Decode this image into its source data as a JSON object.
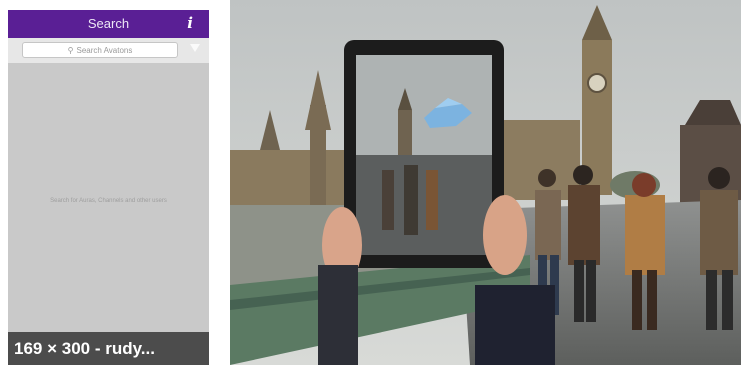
{
  "app": {
    "title": "Search",
    "info_icon": "info-icon",
    "search": {
      "placeholder": "Search Avatons",
      "icon": "search-icon"
    },
    "filter_icon": "filter-icon",
    "empty_message": "Search for Auras, Channels and other users",
    "colors": {
      "header": "#5a1f95",
      "body": "#c9c9c9"
    }
  },
  "thumbnail": {
    "caption": "169 × 300 - rudy..."
  },
  "photo": {
    "description_icon": "ar-photo-big-ben"
  }
}
